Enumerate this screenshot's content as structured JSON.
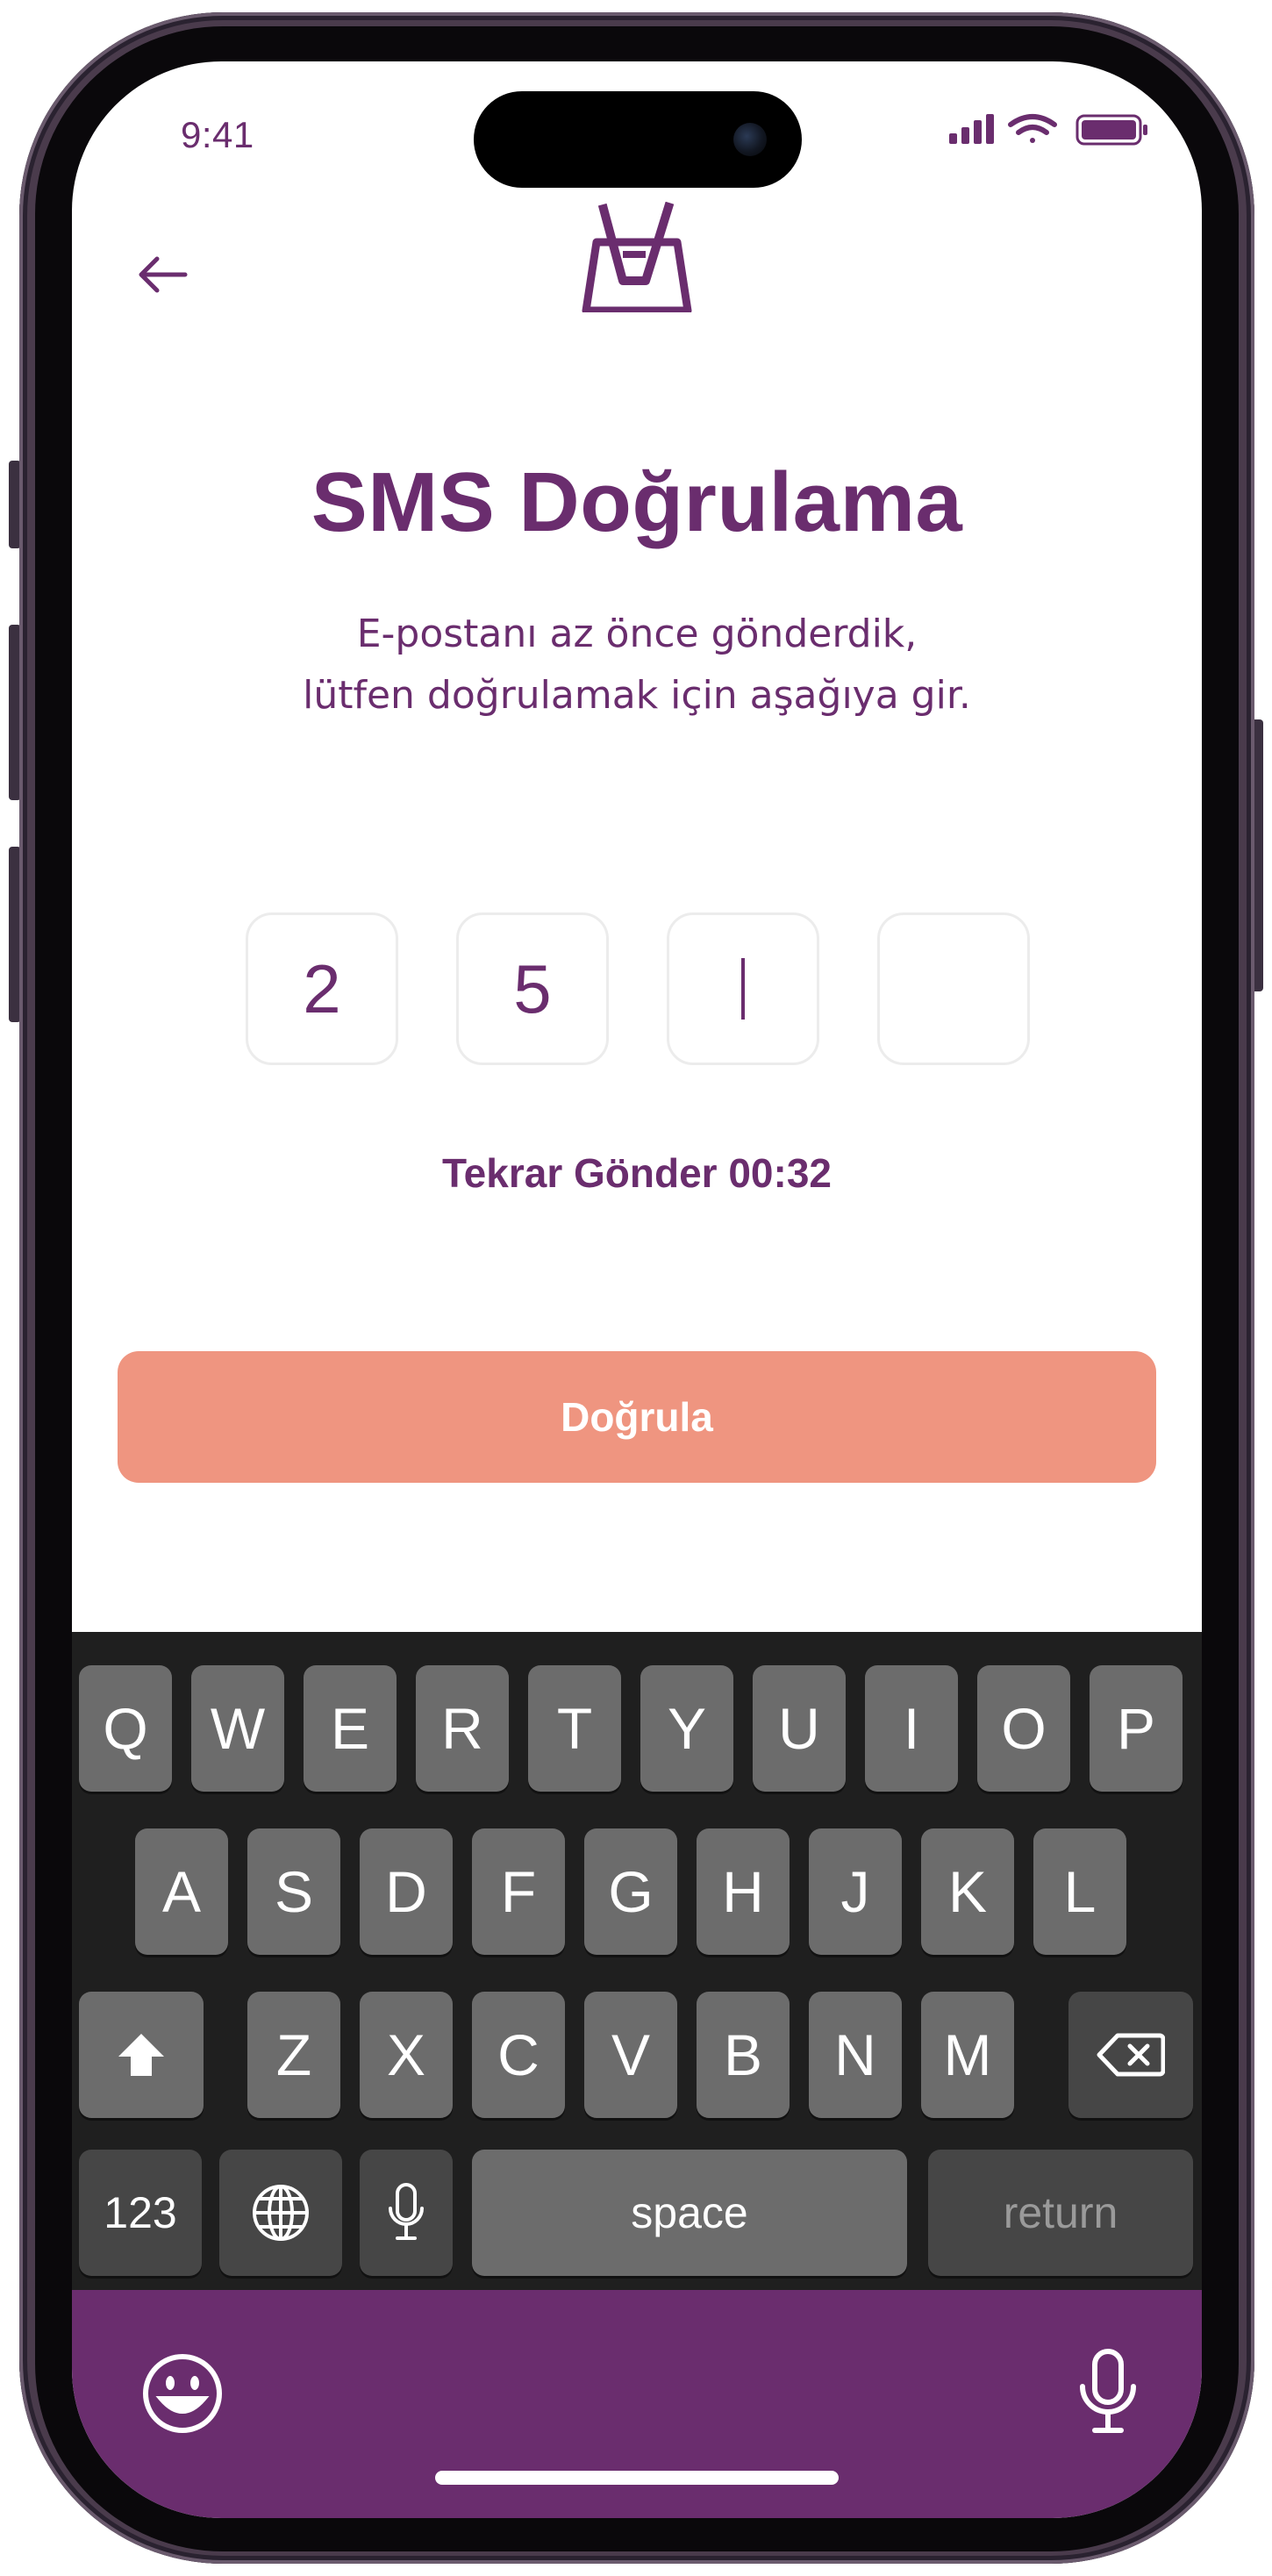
{
  "status": {
    "time": "9:41"
  },
  "header": {
    "back_icon": "arrow-left-icon",
    "logo_icon": "app-logo-icon"
  },
  "content": {
    "title": "SMS Doğrulama",
    "subtitle_line1": "E-postanı az önce gönderdik,",
    "subtitle_line2": "lütfen doğrulamak için aşağıya gir.",
    "code": [
      "2",
      "5",
      "",
      ""
    ],
    "resend": "Tekrar Gönder 00:32",
    "verify": "Doğrula"
  },
  "keyboard": {
    "row1": [
      "Q",
      "W",
      "E",
      "R",
      "T",
      "Y",
      "U",
      "I",
      "O",
      "P"
    ],
    "row2": [
      "A",
      "S",
      "D",
      "F",
      "G",
      "H",
      "J",
      "K",
      "L"
    ],
    "row3": [
      "Z",
      "X",
      "C",
      "V",
      "B",
      "N",
      "M"
    ],
    "num": "123",
    "space": "space",
    "return": "return"
  },
  "colors": {
    "primary": "#6a2d6e",
    "button": "#ef9580",
    "keyboard_bg": "#1f1f1f",
    "key": "#6c6c6c"
  }
}
